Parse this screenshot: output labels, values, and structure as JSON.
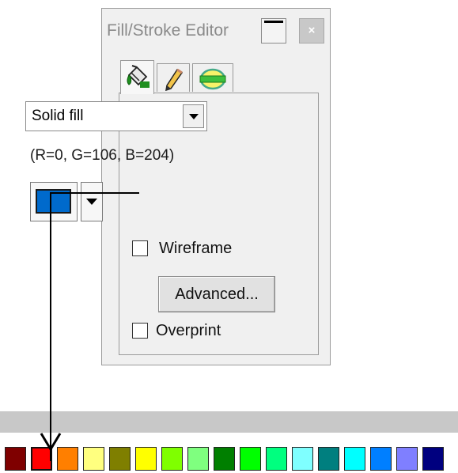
{
  "window": {
    "title": "Fill/Stroke Editor",
    "close_label": "×"
  },
  "tabs": [
    {
      "icon": "paint-bucket-icon"
    },
    {
      "icon": "pencil-icon"
    },
    {
      "icon": "stroke-shape-icon"
    }
  ],
  "fill": {
    "type_selected": "Solid fill",
    "rgb_text": "(R=0, G=106, B=204)",
    "color": "#006acc"
  },
  "options": {
    "wireframe_label": "Wireframe",
    "wireframe_checked": false,
    "advanced_label": "Advanced...",
    "overprint_label": "Overprint",
    "overprint_checked": false
  },
  "palette": {
    "colors": [
      "#7f0000",
      "#ff0000",
      "#ff7f00",
      "#ffff7f",
      "#7f7f00",
      "#ffff00",
      "#7fff00",
      "#7fff7f",
      "#007f00",
      "#00ff00",
      "#00ff7f",
      "#7fffff",
      "#007f7f",
      "#00ffff",
      "#007fff",
      "#7f7fff",
      "#00007f"
    ]
  }
}
